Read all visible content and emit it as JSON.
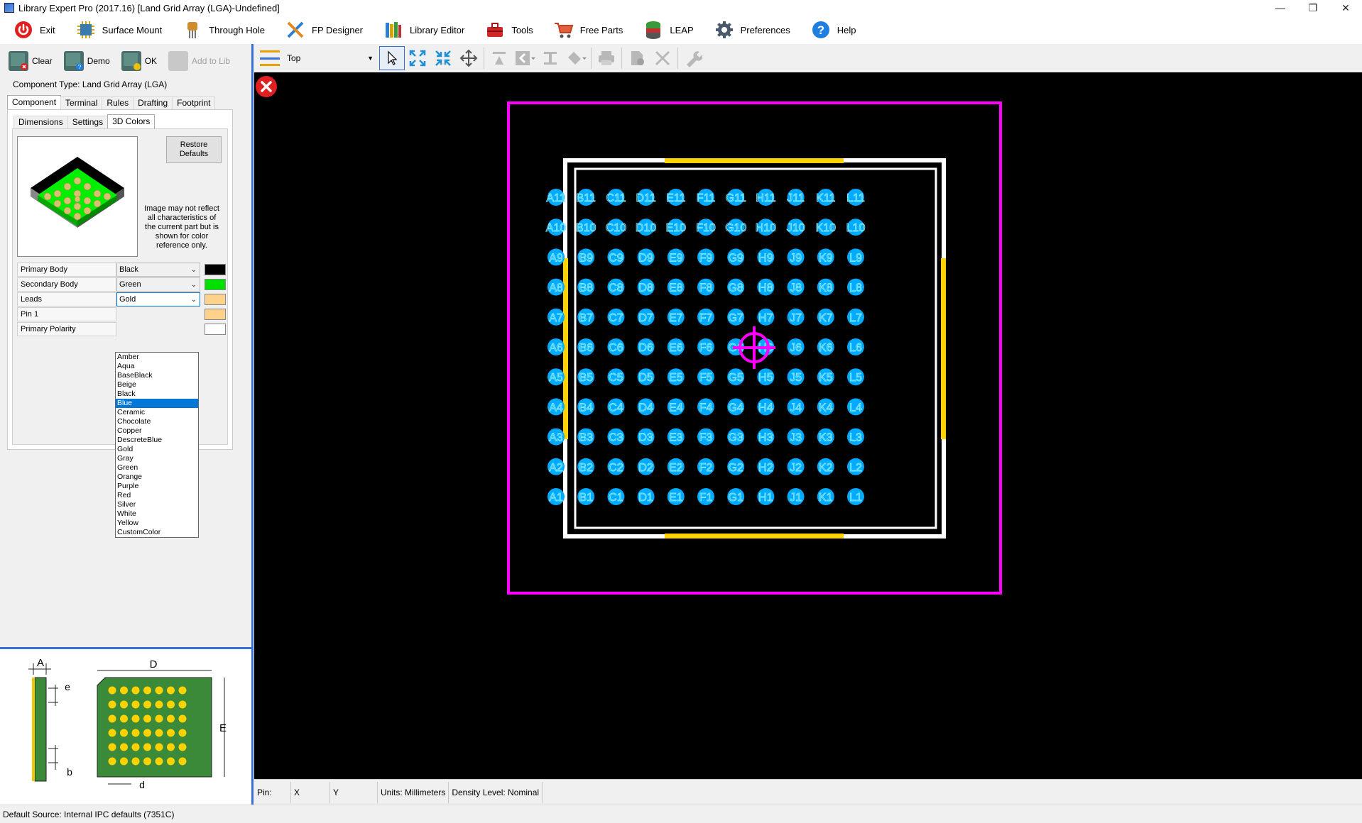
{
  "window": {
    "title": "Library Expert Pro (2017.16) [Land Grid Array (LGA)-Undefined]",
    "controls": [
      "minimize",
      "restore",
      "close"
    ]
  },
  "menubar": {
    "items": [
      {
        "label": "Exit",
        "icon": "power-icon"
      },
      {
        "label": "Surface Mount",
        "icon": "chip-icon"
      },
      {
        "label": "Through Hole",
        "icon": "through-hole-icon"
      },
      {
        "label": "FP Designer",
        "icon": "fp-designer-icon"
      },
      {
        "label": "Library Editor",
        "icon": "library-icon"
      },
      {
        "label": "Tools",
        "icon": "toolbox-icon"
      },
      {
        "label": "Free Parts",
        "icon": "cart-icon"
      },
      {
        "label": "LEAP",
        "icon": "database-icon"
      },
      {
        "label": "Preferences",
        "icon": "gear-icon"
      },
      {
        "label": "Help",
        "icon": "help-icon"
      }
    ]
  },
  "left_toolbar": {
    "clear": "Clear",
    "demo": "Demo",
    "ok": "OK",
    "add_to_lib": "Add to Lib"
  },
  "component_type": "Component Type: Land Grid Array (LGA)",
  "tabs_main": [
    "Component",
    "Terminal",
    "Rules",
    "Drafting",
    "Footprint"
  ],
  "tabs_sub": [
    "Dimensions",
    "Settings",
    "3D Colors"
  ],
  "colors_panel": {
    "restore_button": "Restore Defaults",
    "note": "Image may not reflect all characteristics of the current part but is shown for color reference only.",
    "rows": [
      {
        "label": "Primary Body",
        "value": "Black",
        "swatch": "#000000"
      },
      {
        "label": "Secondary Body",
        "value": "Green",
        "swatch": "#00e000"
      },
      {
        "label": "Leads",
        "value": "Gold",
        "swatch": "#ffd28c"
      },
      {
        "label": "Pin 1",
        "value": "",
        "swatch": "#ffd28c"
      },
      {
        "label": "Primary Polarity",
        "value": "",
        "swatch": "#ffffff"
      }
    ],
    "dropdown_options": [
      "Amber",
      "Aqua",
      "BaseBlack",
      "Beige",
      "Black",
      "Blue",
      "Ceramic",
      "Chocolate",
      "Copper",
      "DescreteBlue",
      "Gold",
      "Gray",
      "Green",
      "Orange",
      "Purple",
      "Red",
      "Silver",
      "White",
      "Yellow",
      "CustomColor"
    ],
    "dropdown_selected": "Blue"
  },
  "dimension_labels": {
    "A": "A",
    "D": "D",
    "E": "E",
    "e": "e",
    "b": "b",
    "d": "d"
  },
  "canvas_toolbar": {
    "layer": "Top"
  },
  "footprint": {
    "columns": [
      "A",
      "B",
      "C",
      "D",
      "E",
      "F",
      "G",
      "H",
      "J",
      "K",
      "L"
    ],
    "rows": [
      "11",
      "10",
      "9",
      "8",
      "7",
      "6",
      "5",
      "4",
      "3",
      "2",
      "1"
    ],
    "colors": {
      "pad": "#00aaff",
      "courtyard": "#ff00ff",
      "silk": "#ffffff",
      "assembly": "#ffd200"
    }
  },
  "statusbar": {
    "pin": "Pin:",
    "x": "X",
    "y": "Y",
    "units": "Units: Millimeters",
    "density": "Density Level: Nominal"
  },
  "bottom_status": "Default Source:  Internal IPC defaults (7351C)"
}
